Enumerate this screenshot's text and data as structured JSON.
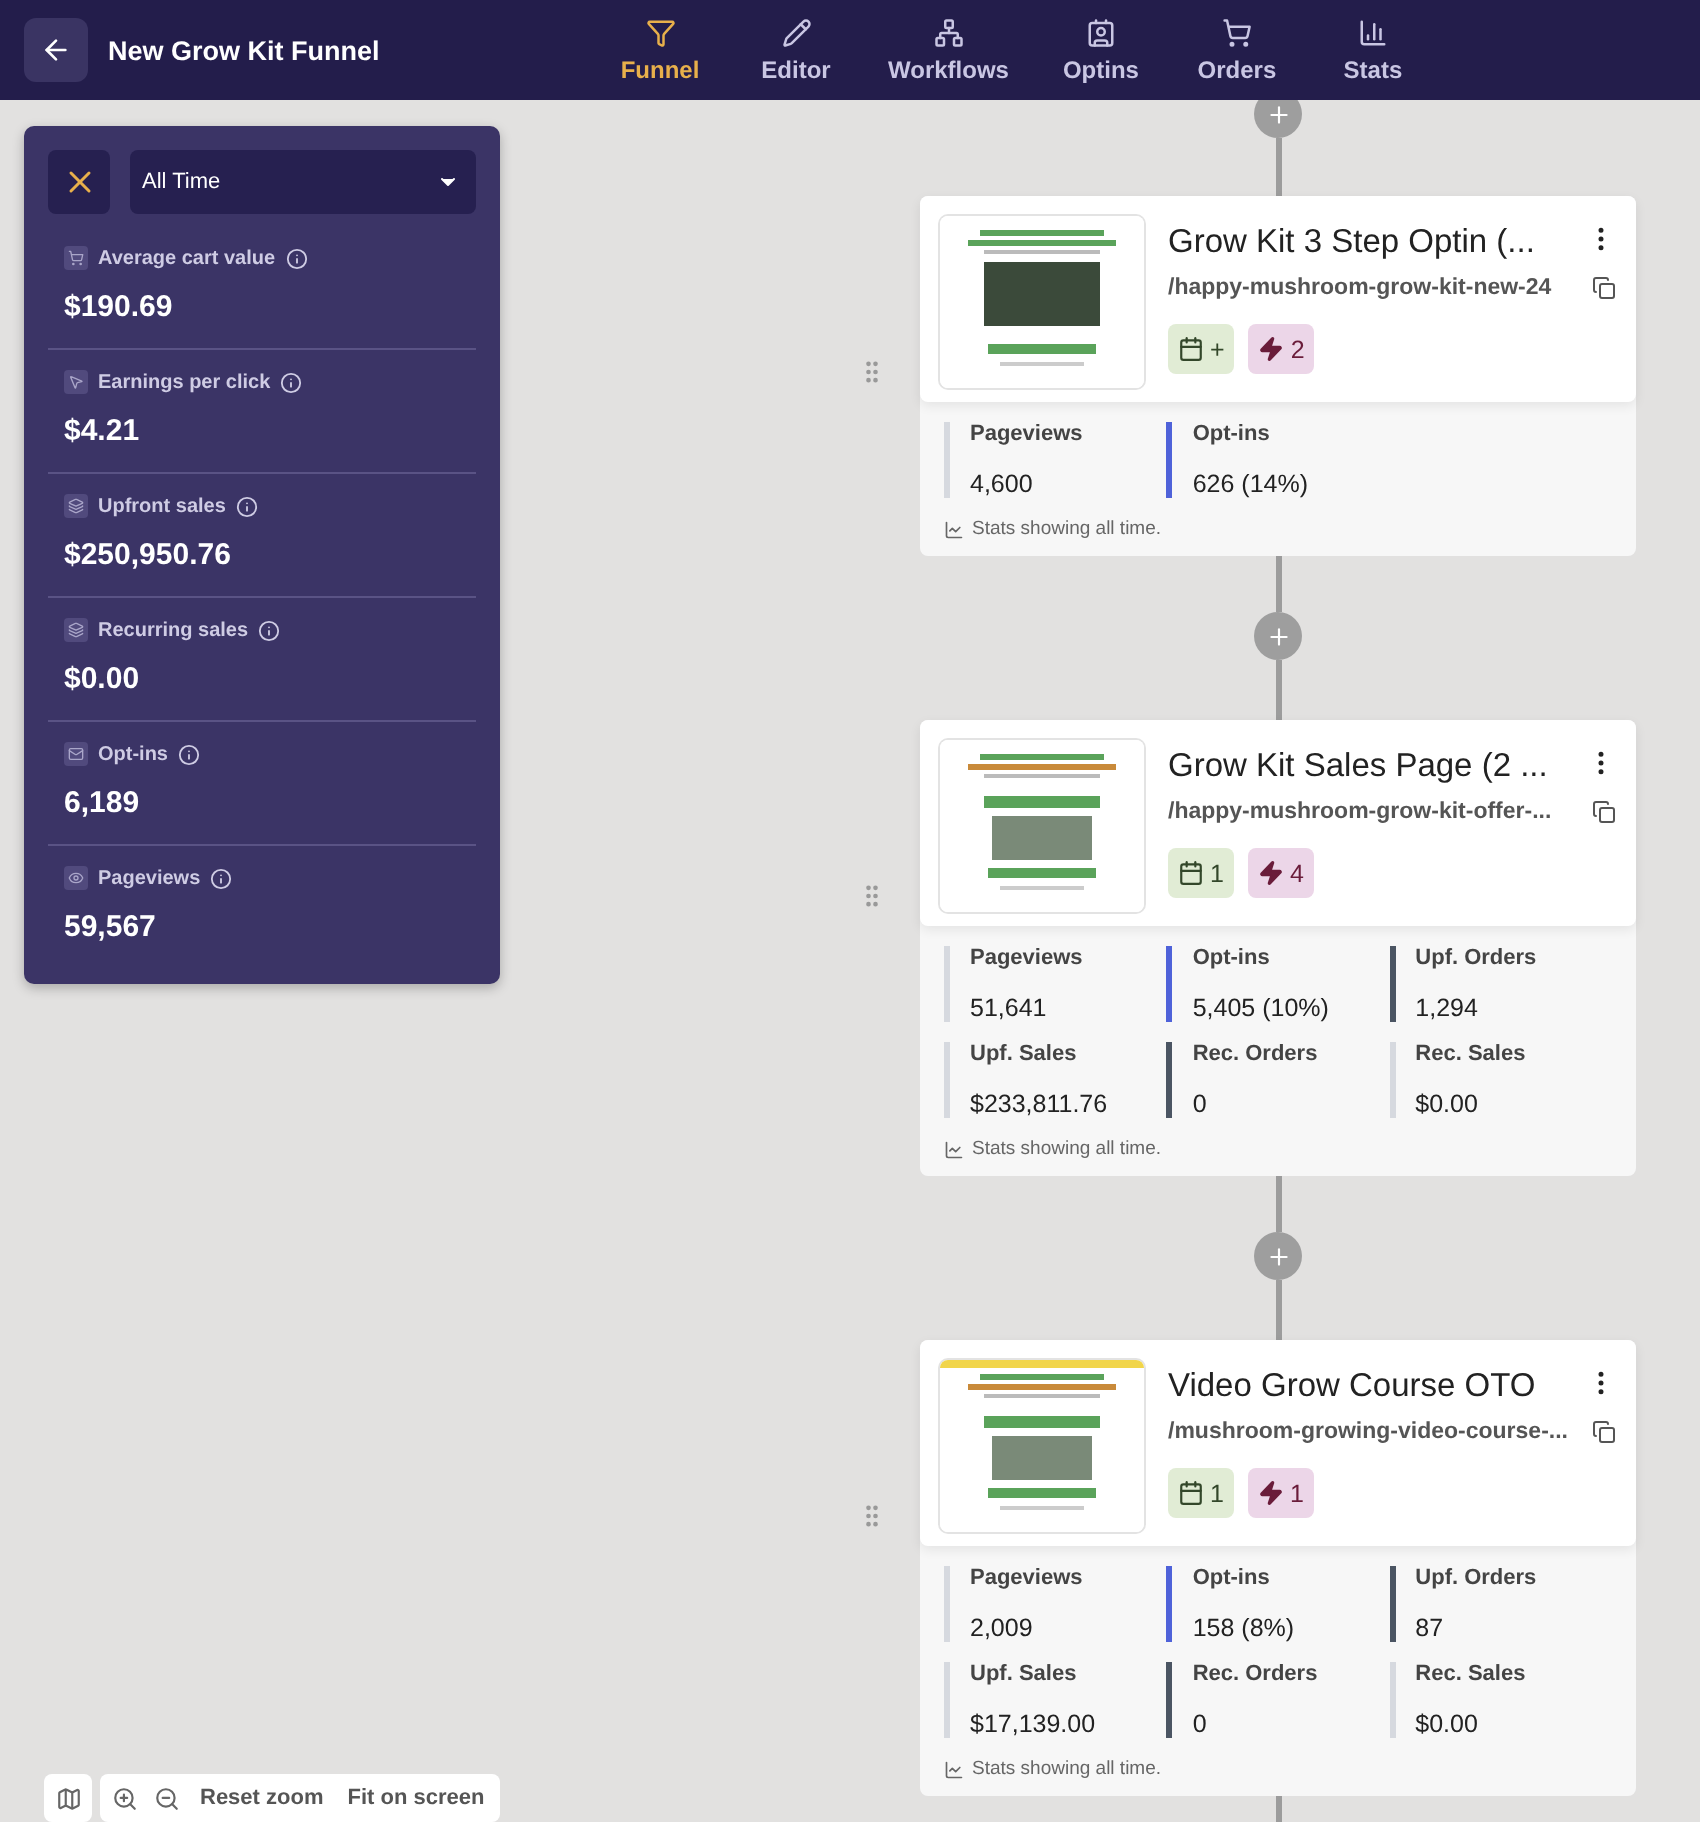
{
  "header": {
    "title": "New Grow Kit Funnel",
    "tabs": [
      {
        "label": "Funnel",
        "kind": "funnel",
        "selected": true
      },
      {
        "label": "Editor",
        "kind": "editor",
        "selected": false
      },
      {
        "label": "Workflows",
        "kind": "workflows",
        "selected": false
      },
      {
        "label": "Optins",
        "kind": "optins",
        "selected": false
      },
      {
        "label": "Orders",
        "kind": "orders",
        "selected": false
      },
      {
        "label": "Stats",
        "kind": "stats",
        "selected": false
      }
    ]
  },
  "stats_panel": {
    "period": "All Time",
    "stats": [
      {
        "kind": "cart",
        "label": "Average cart value",
        "value": "$190.69"
      },
      {
        "kind": "clicks",
        "label": "Earnings per click",
        "value": "$4.21"
      },
      {
        "kind": "sales",
        "label": "Upfront sales",
        "value": "$250,950.76"
      },
      {
        "kind": "sales",
        "label": "Recurring sales",
        "value": "$0.00"
      },
      {
        "kind": "optins",
        "label": "Opt-ins",
        "value": "6,189"
      },
      {
        "kind": "views",
        "label": "Pageviews",
        "value": "59,567"
      }
    ]
  },
  "steps": [
    {
      "title": "Grow Kit 3 Step Optin (...",
      "path": "/happy-mushroom-grow-kit-new-24",
      "badges": [
        {
          "kind": "calendar",
          "text": "+"
        },
        {
          "kind": "bolt",
          "text": "2"
        }
      ],
      "metrics": [
        {
          "label": "Pageviews",
          "value": "4,600",
          "color": "#d6d9df"
        },
        {
          "label": "Opt-ins",
          "value": "626 (14%)",
          "color": "#4f62d9"
        }
      ],
      "note": "Stats showing all time."
    },
    {
      "title": "Grow Kit Sales Page (2 ...",
      "path": "/happy-mushroom-grow-kit-offer-...",
      "badges": [
        {
          "kind": "calendar",
          "text": "1"
        },
        {
          "kind": "bolt",
          "text": "4"
        }
      ],
      "metrics": [
        {
          "label": "Pageviews",
          "value": "51,641",
          "color": "#d6d9df"
        },
        {
          "label": "Opt-ins",
          "value": "5,405 (10%)",
          "color": "#4f62d9"
        },
        {
          "label": "Upf. Orders",
          "value": "1,294",
          "color": "#4b5563"
        },
        {
          "label": "Upf. Sales",
          "value": "$233,811.76",
          "color": "#d6d9df"
        },
        {
          "label": "Rec. Orders",
          "value": "0",
          "color": "#4b5563"
        },
        {
          "label": "Rec. Sales",
          "value": "$0.00",
          "color": "#d6d9df"
        }
      ],
      "note": "Stats showing all time."
    },
    {
      "title": "Video Grow Course OTO",
      "path": "/mushroom-growing-video-course-...",
      "badges": [
        {
          "kind": "calendar",
          "text": "1"
        },
        {
          "kind": "bolt",
          "text": "1"
        }
      ],
      "metrics": [
        {
          "label": "Pageviews",
          "value": "2,009",
          "color": "#d6d9df"
        },
        {
          "label": "Opt-ins",
          "value": "158 (8%)",
          "color": "#4f62d9"
        },
        {
          "label": "Upf. Orders",
          "value": "87",
          "color": "#4b5563"
        },
        {
          "label": "Upf. Sales",
          "value": "$17,139.00",
          "color": "#d6d9df"
        },
        {
          "label": "Rec. Orders",
          "value": "0",
          "color": "#4b5563"
        },
        {
          "label": "Rec. Sales",
          "value": "$0.00",
          "color": "#d6d9df"
        }
      ],
      "note": "Stats showing all time."
    }
  ],
  "zoom_controls": {
    "reset": "Reset zoom",
    "fit": "Fit on screen"
  }
}
